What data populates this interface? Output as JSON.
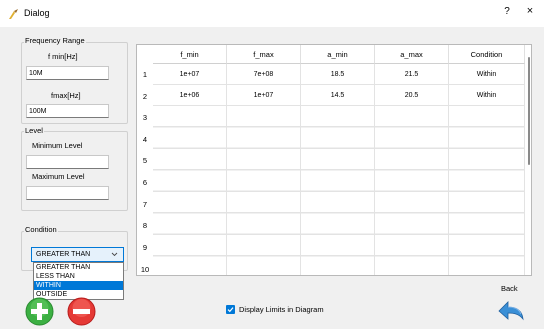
{
  "window": {
    "title": "Dialog",
    "help": "?",
    "close": "×"
  },
  "frequency": {
    "group_label": "Frequency Range",
    "fmin_label": "f min[Hz]",
    "fmin_value": "10M",
    "fmax_label": "fmax[Hz]",
    "fmax_value": "100M"
  },
  "level": {
    "group_label": "Level",
    "min_label": "Minimum Level",
    "min_value": "",
    "max_label": "Maximum Level",
    "max_value": ""
  },
  "condition": {
    "group_label": "Condition",
    "selected": "GREATER THAN",
    "options": [
      "GREATER THAN",
      "LESS THAN",
      "WITHIN",
      "OUTSIDE"
    ],
    "highlighted_index": 2
  },
  "table": {
    "columns": [
      "f_min",
      "f_max",
      "a_min",
      "a_max",
      "Condition"
    ],
    "row_numbers": [
      "1",
      "2",
      "3",
      "4",
      "5",
      "6",
      "7",
      "8",
      "9",
      "10"
    ],
    "rows": [
      [
        "1e+07",
        "7e+08",
        "18.5",
        "21.5",
        "Within"
      ],
      [
        "1e+06",
        "1e+07",
        "14.5",
        "20.5",
        "Within"
      ]
    ]
  },
  "display_limits": {
    "label": "Display Limits in Diagram",
    "checked": true
  },
  "back": {
    "label": "Back"
  },
  "colors": {
    "accent": "#0078d7",
    "add_green": "#3cb043",
    "remove_red": "#e53935",
    "back_arrow": "#3a8fd6"
  }
}
